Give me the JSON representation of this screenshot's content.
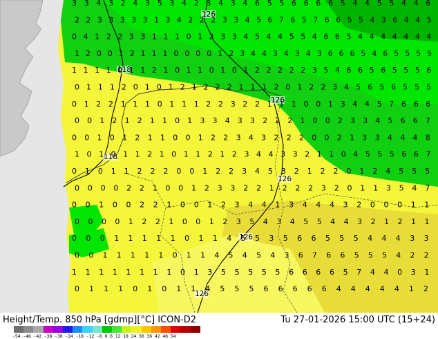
{
  "title": "Height/Temp. 850 hPa [gdmp][°C] ICON-D2",
  "valid_time": "Tu 27-01-2026 15:00 UTC (15+24)",
  "colors": {
    "land_outside": "#c9c9c9",
    "sea_outside": "#e6e6e6",
    "green_bright": "#00e600",
    "green_mid": "#11cf11",
    "green_dark": "#00b400",
    "yellow": "#f5f53a",
    "yellow_light": "#f7f75f",
    "mustard": "#e8dd38",
    "border": "#333333",
    "contour": "#000000"
  },
  "colorbar": {
    "labels": [
      "-54",
      "-48",
      "-42",
      "-38",
      "-30",
      "-24",
      "-18",
      "-12",
      "-6",
      "0",
      "6",
      "12",
      "18",
      "24",
      "30",
      "36",
      "42",
      "48",
      "54"
    ],
    "colors": [
      "#6e6e6e",
      "#8c8c8c",
      "#aaaaaa",
      "#c800c8",
      "#9600dc",
      "#1e1ee6",
      "#1e8cf0",
      "#3cd2ff",
      "#78e6c8",
      "#00c800",
      "#46e63c",
      "#c8f01e",
      "#f0f028",
      "#ffc800",
      "#ff9600",
      "#ff5000",
      "#dc0000",
      "#b40000",
      "#8c0000"
    ]
  },
  "isohypse_labels": [
    "126",
    "118",
    "126",
    "118",
    "126",
    "126",
    "126"
  ],
  "value_rows": [
    "3 3 4 3 2 4 3 5 3 4 2 3 4 3 4 6 5 5 6 6 6 6 5 4 4 5 5 4 4 6",
    "2 2 3 3 3 3 3 1 3 4 2 2 2 3 3 4 5 6 7 6 5 7 6 6 5 5 4 3 6 4 4 5",
    "0 4 1 2 2 3 3 1 1 1 0 1 2 3 3 4 5 4 4 5 5 4 6 6 5 4 4 4 4 4 4 4",
    "1 2 0 0 1 2 1 1 1 0 0 0 0 1 2 3 4 4 3 4 3 4 3 6 6 6 5 4 6 5 5 5 5",
    "1 1 1 1 0 1 1 2 1 0 1 1 0 1 0 1 2 2 2 2 2 3 5 4 6 6 5 6 5 5 5 6",
    "0 1 1 1 2 0 1 0 1 2 1 2 2 2 1 1 1 2 0 1 2 2 3 4 5 6 5 6 5 5 5",
    "0 1 2 2 1 1 1 0 1 1 1 2 2 3 2 2 1 1 1 0 0 1 3 4 4 5 7 6 6 6",
    "0 0 1 2 1 2 1 1 0 1 3 3 4 3 3 2 2 2 1 0 0 2 3 3 4 5 6 6 7",
    "0 0 1 0 1 2 1 1 0 0 1 2 2 3 4 3 2 2 2 0 0 2 1 3 3 4 4 4 8",
    "1 0 1 0 1 1 2 1 0 1 1 2 1 2 3 4 4 3 3 2 1 1 0 4 5 5 5 6 6 7",
    "0 1 0 1 1 2 2 2 0 0 1 2 2 3 4 5 3 2 1 2 2 0 1 2 4 5 5 5",
    "0 0 0 0 2 2 1 0 0 1 2 3 3 2 2 1 2 2 2 3 2 0 1 1 3 5 4 7",
    "0 0 1 0 0 2 2 1 0 0 1 2 3 4 4 1 3 4 4 4 3 2 0 0 0 1 1",
    "0 0 0 0 1 2 2 1 0 0 1 2 3 5 4 3 4 5 5 4 4 3 2 1 2 1 1",
    "0 0 0 1 1 1 1 1 0 1 1 4 5 5 3 5 6 6 5 5 5 4 4 4 3 3",
    "0 0 1 1 1 1 1 0 1 1 4 5 4 5 4 3 6 7 6 6 5 5 5 4 2 2",
    "1 1 1 1 1 1 1 1 0 1 3 5 5 5 5 5 6 6 6 6 5 7 4 4 0 3 1",
    "0 1 1 1 0 1 0 1 1 4 5 5 5 6 6 6 6 6 4 4 4 4 4 1 2"
  ]
}
